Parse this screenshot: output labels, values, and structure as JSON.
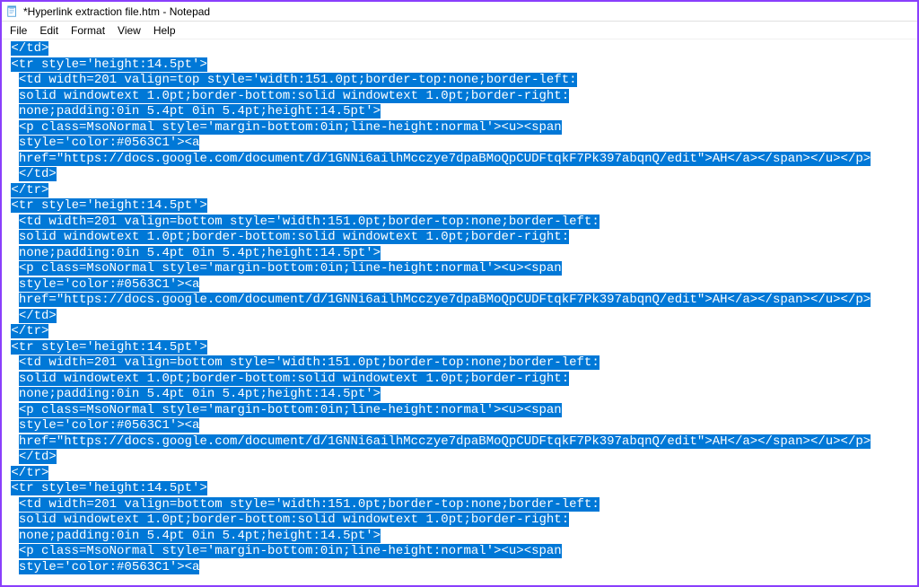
{
  "window": {
    "title": "*Hyperlink extraction file.htm - Notepad"
  },
  "menu": {
    "file": "File",
    "edit": "Edit",
    "format": "Format",
    "view": "View",
    "help": "Help"
  },
  "content": {
    "lines": [
      " </td>",
      " <tr style='height:14.5pt'>",
      "  <td width=201 valign=top style='width:151.0pt;border-top:none;border-left:",
      "  solid windowtext 1.0pt;border-bottom:solid windowtext 1.0pt;border-right:",
      "  none;padding:0in 5.4pt 0in 5.4pt;height:14.5pt'>",
      "  <p class=MsoNormal style='margin-bottom:0in;line-height:normal'><u><span",
      "  style='color:#0563C1'><a",
      "  href=\"https://docs.google.com/document/d/1GNNi6ailhMcczye7dpaBMoQpCUDFtqkF7Pk397abqnQ/edit\">AH</a></span></u></p>",
      "  </td>",
      " </tr>",
      " <tr style='height:14.5pt'>",
      "  <td width=201 valign=bottom style='width:151.0pt;border-top:none;border-left:",
      "  solid windowtext 1.0pt;border-bottom:solid windowtext 1.0pt;border-right:",
      "  none;padding:0in 5.4pt 0in 5.4pt;height:14.5pt'>",
      "  <p class=MsoNormal style='margin-bottom:0in;line-height:normal'><u><span",
      "  style='color:#0563C1'><a",
      "  href=\"https://docs.google.com/document/d/1GNNi6ailhMcczye7dpaBMoQpCUDFtqkF7Pk397abqnQ/edit\">AH</a></span></u></p>",
      "  </td>",
      " </tr>",
      " <tr style='height:14.5pt'>",
      "  <td width=201 valign=bottom style='width:151.0pt;border-top:none;border-left:",
      "  solid windowtext 1.0pt;border-bottom:solid windowtext 1.0pt;border-right:",
      "  none;padding:0in 5.4pt 0in 5.4pt;height:14.5pt'>",
      "  <p class=MsoNormal style='margin-bottom:0in;line-height:normal'><u><span",
      "  style='color:#0563C1'><a",
      "  href=\"https://docs.google.com/document/d/1GNNi6ailhMcczye7dpaBMoQpCUDFtqkF7Pk397abqnQ/edit\">AH</a></span></u></p>",
      "  </td>",
      " </tr>",
      " <tr style='height:14.5pt'>",
      "  <td width=201 valign=bottom style='width:151.0pt;border-top:none;border-left:",
      "  solid windowtext 1.0pt;border-bottom:solid windowtext 1.0pt;border-right:",
      "  none;padding:0in 5.4pt 0in 5.4pt;height:14.5pt'>",
      "  <p class=MsoNormal style='margin-bottom:0in;line-height:normal'><u><span",
      "  style='color:#0563C1'><a"
    ]
  },
  "colors": {
    "selection_bg": "#0078d7",
    "selection_fg": "#ffffff",
    "border": "#8a3ffc"
  }
}
